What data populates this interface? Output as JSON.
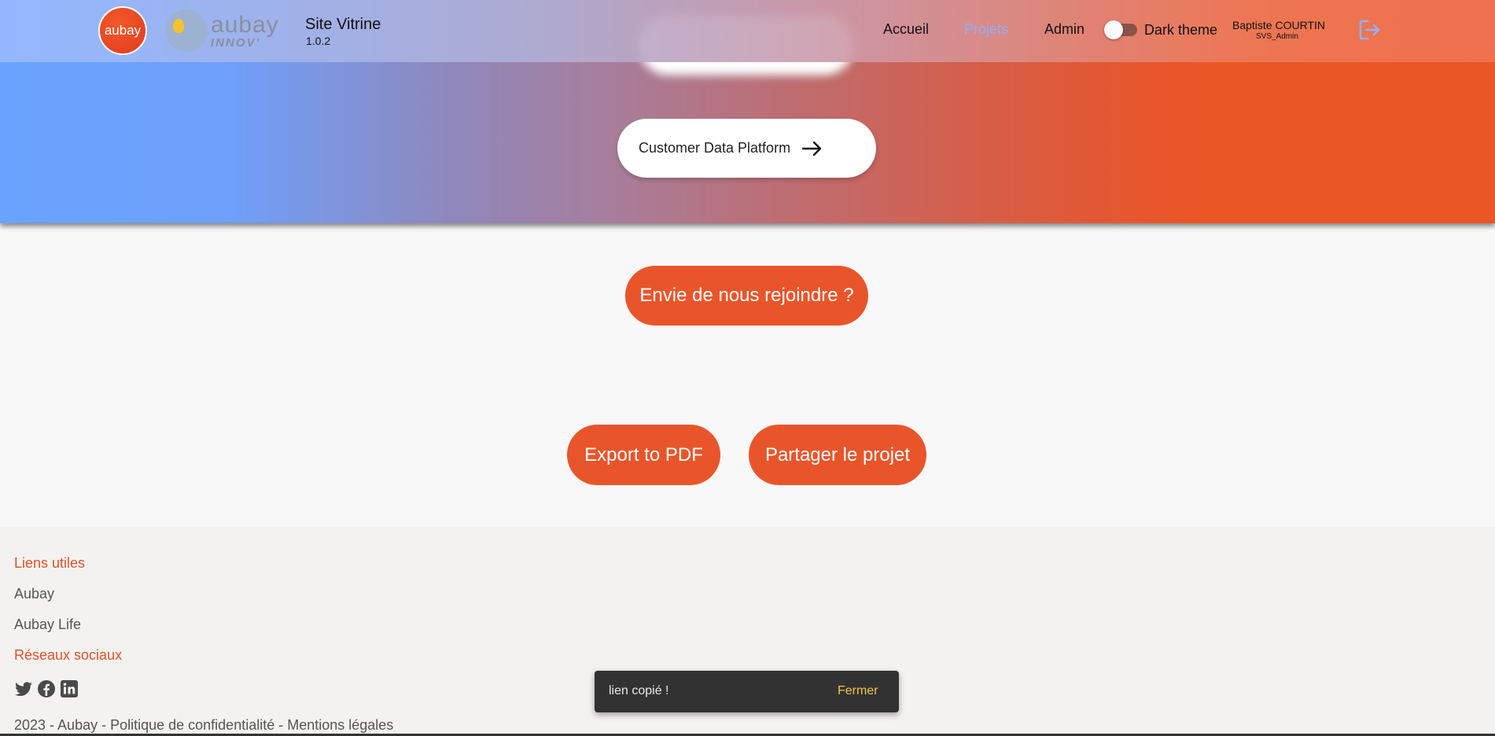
{
  "brand": {
    "aubay_logo_text": "aubay",
    "innov_logo_text": "aubay",
    "innov_logo_sub": "INNOV'",
    "app_title": "Site Vitrine",
    "app_version": "1.0.2"
  },
  "nav": {
    "items": [
      {
        "label": "Accueil"
      },
      {
        "label": "Projets"
      },
      {
        "label": "Admin"
      }
    ],
    "dark_theme_label": "Dark theme",
    "dark_theme_on": false,
    "user_name": "Baptiste COURTIN",
    "user_role": "SVS_Admin"
  },
  "hero": {
    "cdp_button_label": "Customer Data Platform"
  },
  "main": {
    "join_button_label": "Envie de nous rejoindre ?",
    "export_pdf_label": "Export to PDF",
    "share_project_label": "Partager le projet"
  },
  "footer": {
    "useful_links_heading": "Liens utiles",
    "useful_links": [
      {
        "label": "Aubay"
      },
      {
        "label": "Aubay Life"
      }
    ],
    "social_heading": "Réseaux sociaux",
    "social_icons": [
      "twitter-icon",
      "facebook-icon",
      "linkedin-icon"
    ],
    "copyright": "2023 - Aubay - Politique de confidentialité - Mentions légales"
  },
  "snackbar": {
    "message": "lien copié !",
    "action_label": "Fermer"
  },
  "colors": {
    "accent_orange": "#e9552a",
    "gradient_start": "#6aa3ff",
    "gradient_end": "#ec5526",
    "snackbar_bg": "#323232",
    "snackbar_action": "#f4c542"
  }
}
